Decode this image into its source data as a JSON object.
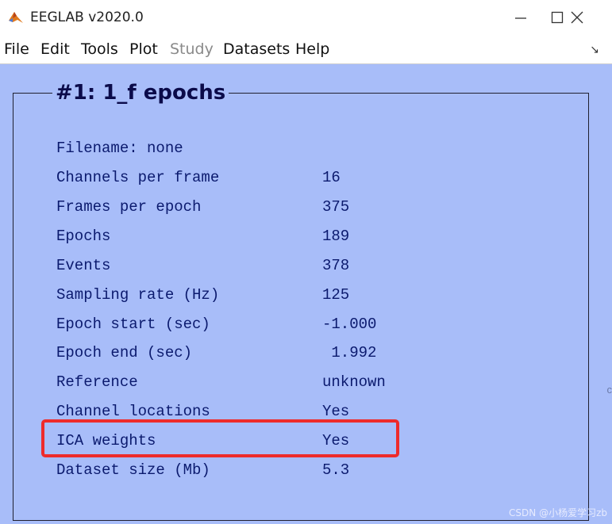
{
  "window": {
    "title": "EEGLAB v2020.0",
    "minimize_glyph": "─",
    "maximize_glyph": "☐",
    "close_glyph": "✕",
    "icon": "matlab-icon"
  },
  "menu": {
    "items": [
      {
        "label": "File",
        "enabled": true
      },
      {
        "label": "Edit",
        "enabled": true
      },
      {
        "label": "Tools",
        "enabled": true
      },
      {
        "label": "Plot",
        "enabled": true
      },
      {
        "label": "Study",
        "enabled": false
      },
      {
        "label": "Datasets",
        "enabled": true
      },
      {
        "label": "Help",
        "enabled": true
      }
    ],
    "corner_glyph": "↘"
  },
  "panel": {
    "title": "#1: 1_f epochs",
    "rows": [
      {
        "label": "Filename: none",
        "value": ""
      },
      {
        "label": "Channels per frame",
        "value": "16"
      },
      {
        "label": "Frames per epoch",
        "value": "375"
      },
      {
        "label": "Epochs",
        "value": "189"
      },
      {
        "label": "Events",
        "value": "378"
      },
      {
        "label": "Sampling rate (Hz)",
        "value": "125"
      },
      {
        "label": "Epoch start (sec)",
        "value": "-1.000"
      },
      {
        "label": "Epoch end (sec)",
        "value": " 1.992"
      },
      {
        "label": "Reference",
        "value": "unknown"
      },
      {
        "label": "Channel locations",
        "value": "Yes"
      },
      {
        "label": "ICA weights",
        "value": "Yes"
      },
      {
        "label": "Dataset size (Mb)",
        "value": "5.3"
      }
    ]
  },
  "overlay": {
    "watermark": "CSDN @小杨爱学习zb",
    "edge_fragment": "c"
  },
  "colors": {
    "background": "#a8bdf9",
    "text": "#0b1a6e",
    "title": "#0b0b4a",
    "highlight": "#ee2b2b"
  }
}
